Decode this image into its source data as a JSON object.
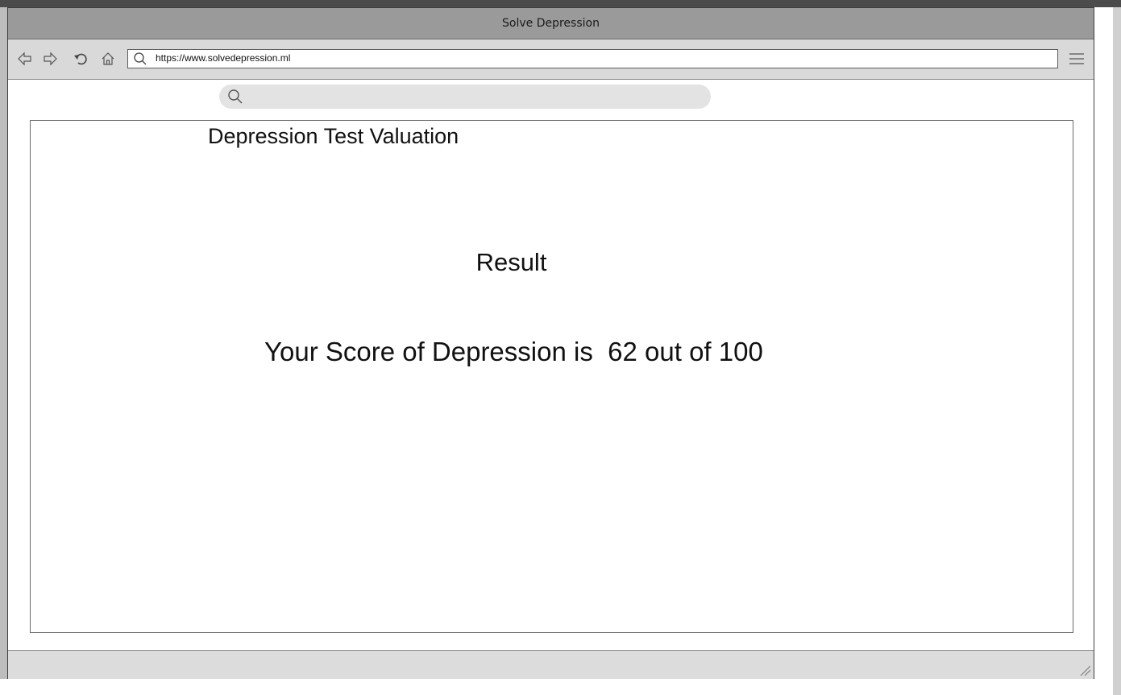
{
  "window": {
    "title": "Solve Depression"
  },
  "toolbar": {
    "url": "https://www.solvedepression.ml",
    "icons": [
      "back-icon",
      "forward-icon",
      "reload-icon",
      "home-icon",
      "search-icon",
      "menu-icon"
    ]
  },
  "search": {
    "placeholder": ""
  },
  "panel": {
    "title": "Depression Test Valuation",
    "result_heading": "Result",
    "score_text": "Your Score of Depression is  62 out of 100"
  },
  "colors": {
    "titlebar": "#9a9a9a",
    "toolbar": "#d9d9d9",
    "search_pill": "#e3e3e3",
    "statusbar": "#dcdcdc"
  }
}
